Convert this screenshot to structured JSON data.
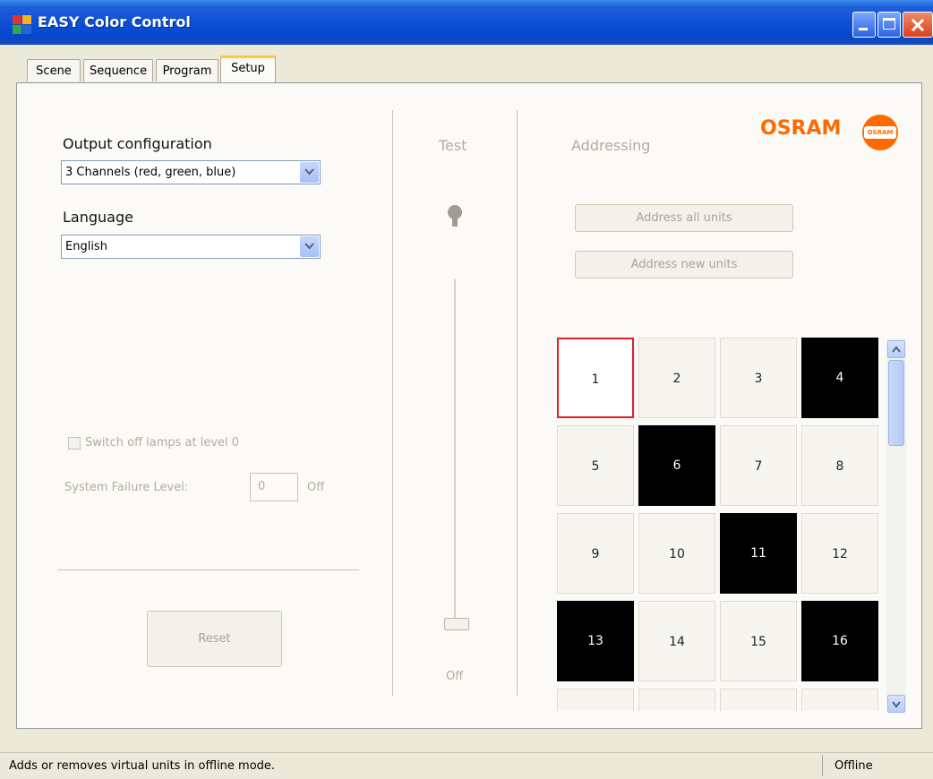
{
  "window": {
    "title": "EASY Color Control"
  },
  "tabs": [
    {
      "label": "Scene"
    },
    {
      "label": "Sequence"
    },
    {
      "label": "Program"
    },
    {
      "label": "Setup"
    }
  ],
  "setup": {
    "output_configuration": {
      "label": "Output configuration",
      "value": "3 Channels (red, green, blue)"
    },
    "language": {
      "label": "Language",
      "value": "English"
    },
    "switch_off_checkbox": {
      "label": "Switch off lamps at level 0",
      "checked": false
    },
    "system_failure": {
      "label": "System Failure Level:",
      "value": "0",
      "unit": "Off"
    },
    "reset_label": "Reset"
  },
  "test": {
    "heading": "Test",
    "slider_value_text": "Off",
    "slider_level": 0
  },
  "addressing": {
    "heading": "Addressing",
    "address_all_label": "Address all units",
    "address_new_label": "Address new units"
  },
  "logo": {
    "text": "OSRAM",
    "badge_text": "OSRAM",
    "color": "#ff6a00"
  },
  "units": [
    {
      "label": "1",
      "state": "white",
      "selected": true
    },
    {
      "label": "2",
      "state": "white"
    },
    {
      "label": "3",
      "state": "white"
    },
    {
      "label": "4",
      "state": "black"
    },
    {
      "label": "5",
      "state": "white"
    },
    {
      "label": "6",
      "state": "black"
    },
    {
      "label": "7",
      "state": "white"
    },
    {
      "label": "8",
      "state": "white"
    },
    {
      "label": "9",
      "state": "white"
    },
    {
      "label": "10",
      "state": "white"
    },
    {
      "label": "11",
      "state": "black"
    },
    {
      "label": "12",
      "state": "white"
    },
    {
      "label": "13",
      "state": "black"
    },
    {
      "label": "14",
      "state": "white"
    },
    {
      "label": "15",
      "state": "white"
    },
    {
      "label": "16",
      "state": "black"
    }
  ],
  "statusbar": {
    "message": "Adds or removes virtual units in offline mode.",
    "connection": "Offline"
  }
}
